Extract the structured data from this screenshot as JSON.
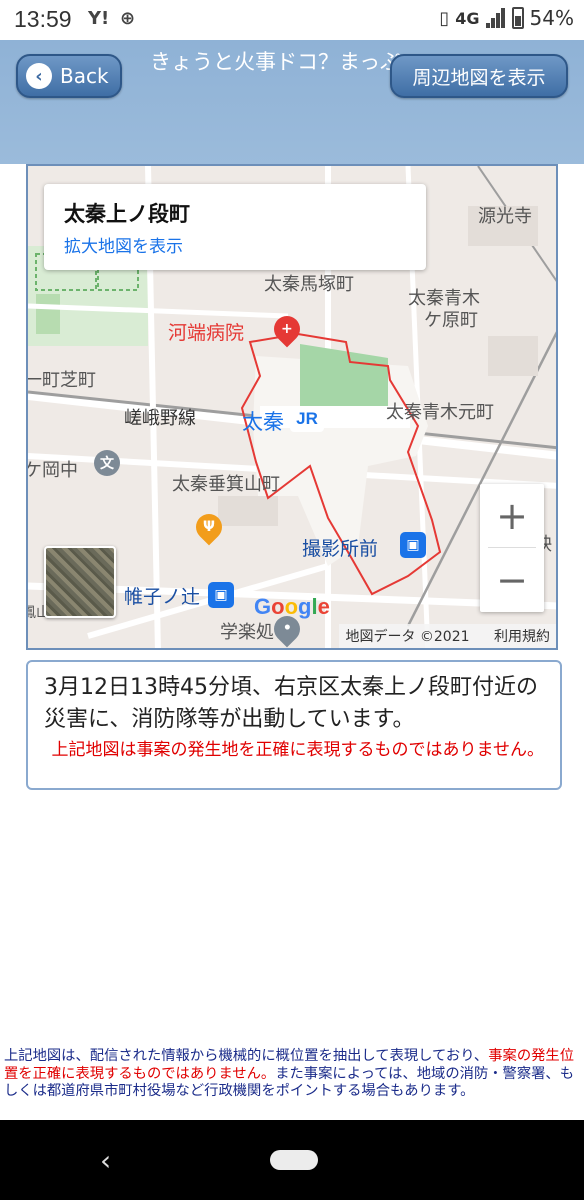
{
  "status_bar": {
    "time": "13:59",
    "notification_icons": [
      "yahoo-icon",
      "vpn-icon"
    ],
    "network": "4G",
    "battery": "54%"
  },
  "header": {
    "title": "きょうと火事ドコ？まっぷ",
    "back_label": "Back",
    "map_button_label": "周辺地図を表示"
  },
  "map": {
    "place_name": "太秦上ノ段町",
    "enlarge_link": "拡大地図を表示",
    "labels": {
      "genkoji": "源光寺",
      "umatsuka": "太秦馬塚町",
      "aoki_kegahara_1": "太秦青木",
      "aoki_kegahara_2": "ケ原町",
      "kawabata": "河端病院",
      "shiba": "一町芝町",
      "sagano": "嵯峨野線",
      "uzumasa": "太秦",
      "aoki_motomachi": "太秦青木元町",
      "okanaka": "ケ岡中",
      "minoyama": "太秦垂箕山町",
      "satsueisho": "撮影所前",
      "eboshi": "帷子ノ辻",
      "gakurakuen": "学楽処",
      "ei": "映",
      "sanpu": "鳳山"
    },
    "jr_badge": "JR",
    "zoom_in": "+",
    "zoom_out": "−",
    "google": "Google",
    "map_data": "地図データ ©2021",
    "terms": "利用規約"
  },
  "message": {
    "main": "3月12日13時45分頃、右京区太秦上ノ段町付近の災害に、消防隊等が出動しています。",
    "warning": "上記地図は事案の発生地を正確に表現するものではありません。"
  },
  "footer": {
    "part1": "上記地図は、配信された情報から機械的に概位置を抽出して表現しており、",
    "part_red": "事案の発生位置を正確に表現するものではありません。",
    "part2": "また事案によっては、地域の消防・警察署、もしくは都道府県市町村役場など行政機関をポイントする場合もあります。"
  },
  "colors": {
    "header_bg": "#9bbbdb",
    "button_bg": "#4a78ad",
    "warning_red": "#e00000",
    "link_blue": "#1a73e8",
    "boundary_red": "#e53935"
  }
}
